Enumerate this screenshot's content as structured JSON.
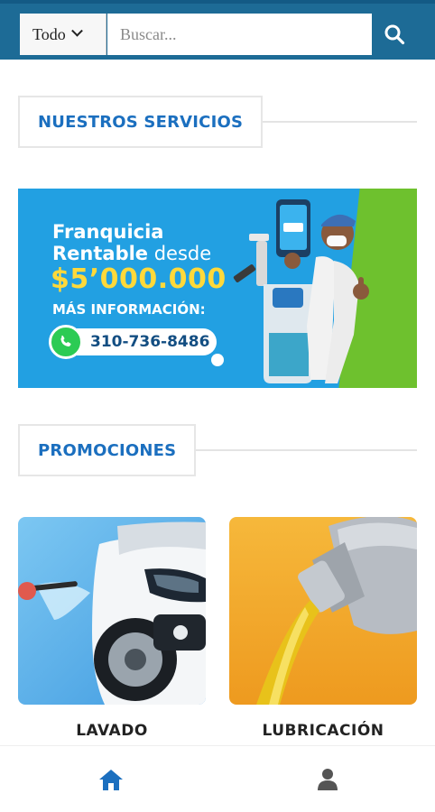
{
  "search": {
    "scope_label": "Todo",
    "placeholder": "Buscar..."
  },
  "sections": {
    "services_title": "NUESTROS SERVICIOS",
    "promos_title": "PROMOCIONES"
  },
  "banner": {
    "line1": "Franquicia",
    "line2_bold": "Rentable",
    "line2_rest": " desde",
    "price": "$5’000.000",
    "info": "MÁS INFORMACIÓN:",
    "phone": "310-736-8486"
  },
  "promotions": [
    {
      "label": "LAVADO"
    },
    {
      "label": "LUBRICACIÓN"
    }
  ],
  "colors": {
    "header": "#1d6b96",
    "accent": "#1b6fbf",
    "banner_blue": "#22a0e2",
    "banner_green": "#6ec12e",
    "price_yellow": "#ffd93a"
  },
  "icons": {
    "search": "magnifier",
    "scope_dropdown": "chevron-down",
    "nav_home": "house",
    "nav_user": "person"
  }
}
